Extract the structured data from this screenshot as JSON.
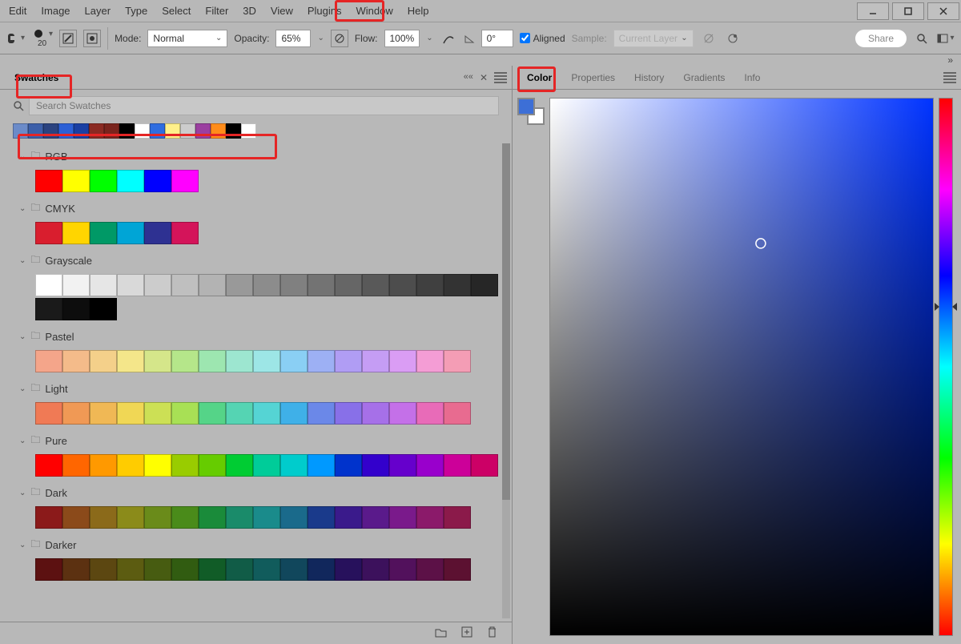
{
  "menu": [
    "Edit",
    "Image",
    "Layer",
    "Type",
    "Select",
    "Filter",
    "3D",
    "View",
    "Plugins",
    "Window",
    "Help"
  ],
  "brush_size": "20",
  "opt": {
    "mode_label": "Mode:",
    "mode_value": "Normal",
    "opacity_label": "Opacity:",
    "opacity_value": "65%",
    "flow_label": "Flow:",
    "flow_value": "100%",
    "angle_value": "0°",
    "aligned": "Aligned",
    "sample_label": "Sample:",
    "sample_value": "Current Layer",
    "share": "Share"
  },
  "swatches_tab": "Swatches",
  "search_placeholder": "Search Swatches",
  "recent_colors": [
    "#6b8bc9",
    "#3c5fa9",
    "#2b4380",
    "#2c60d6",
    "#1a3fa3",
    "#8b2a22",
    "#7a241d",
    "#000000",
    "#ffffff",
    "#2f6de0",
    "#fff08a",
    "#cccccc",
    "#9b3fa0",
    "#ff8c1a",
    "#000000",
    "#ffffff"
  ],
  "groups": [
    {
      "name": "RGB",
      "rows": [
        [
          "#ff0000",
          "#ffff00",
          "#00ff00",
          "#00ffff",
          "#0000ff",
          "#ff00ff"
        ]
      ]
    },
    {
      "name": "CMYK",
      "rows": [
        [
          "#d91e2e",
          "#ffd500",
          "#009966",
          "#00a5d6",
          "#2e3192",
          "#d4145a"
        ]
      ]
    },
    {
      "name": "Grayscale",
      "rows": [
        [
          "#ffffff",
          "#f2f2f2",
          "#e6e6e6",
          "#d9d9d9",
          "#cccccc",
          "#bfbfbf",
          "#b3b3b3",
          "#999999",
          "#8c8c8c",
          "#808080",
          "#737373",
          "#666666",
          "#595959",
          "#4d4d4d",
          "#404040",
          "#333333",
          "#262626"
        ],
        [
          "#1a1a1a",
          "#0d0d0d",
          "#000000"
        ]
      ]
    },
    {
      "name": "Pastel",
      "rows": [
        [
          "#f4a58a",
          "#f4bb8a",
          "#f4d08a",
          "#f4e68a",
          "#d5e68a",
          "#b5e68a",
          "#9de6b0",
          "#9de6d0",
          "#9de6e6",
          "#8acff4",
          "#9db0f4",
          "#b09df4",
          "#c59df4",
          "#da9df4",
          "#f49dd5",
          "#f49db5"
        ]
      ]
    },
    {
      "name": "Light",
      "rows": [
        [
          "#f07a55",
          "#f09955",
          "#f0b855",
          "#f0d755",
          "#cce055",
          "#a8e055",
          "#55d488",
          "#55d4b3",
          "#55d4d4",
          "#3fb0e8",
          "#6b88e8",
          "#8870e8",
          "#a670e8",
          "#c470e8",
          "#e86bb8",
          "#e86b90"
        ]
      ]
    },
    {
      "name": "Pure",
      "rows": [
        [
          "#ff0000",
          "#ff6600",
          "#ff9900",
          "#ffcc00",
          "#ffff00",
          "#99cc00",
          "#66cc00",
          "#00cc33",
          "#00cc99",
          "#00cccc",
          "#0099ff",
          "#0033cc",
          "#3300cc",
          "#6600cc",
          "#9900cc",
          "#cc0099",
          "#cc0066"
        ]
      ]
    },
    {
      "name": "Dark",
      "rows": [
        [
          "#8b1a1a",
          "#8b4a1a",
          "#8b6a1a",
          "#8b8b1a",
          "#6a8b1a",
          "#4a8b1a",
          "#1a8b3a",
          "#1a8b6a",
          "#1a8b8b",
          "#1a6a8b",
          "#1a3a8b",
          "#3a1a8b",
          "#5a1a8b",
          "#7a1a8b",
          "#8b1a6a",
          "#8b1a4a"
        ]
      ]
    },
    {
      "name": "Darker",
      "rows": [
        [
          "#5c1111",
          "#5c3111",
          "#5c4711",
          "#5c5c11",
          "#475c11",
          "#315c11",
          "#115c27",
          "#115c47",
          "#115c5c",
          "#11475c",
          "#11275c",
          "#27115c",
          "#3c115c",
          "#52115c",
          "#5c1147",
          "#5c1131"
        ]
      ]
    }
  ],
  "right_tabs": [
    "Color",
    "Properties",
    "History",
    "Gradients",
    "Info"
  ],
  "active_right_tab": "Color"
}
